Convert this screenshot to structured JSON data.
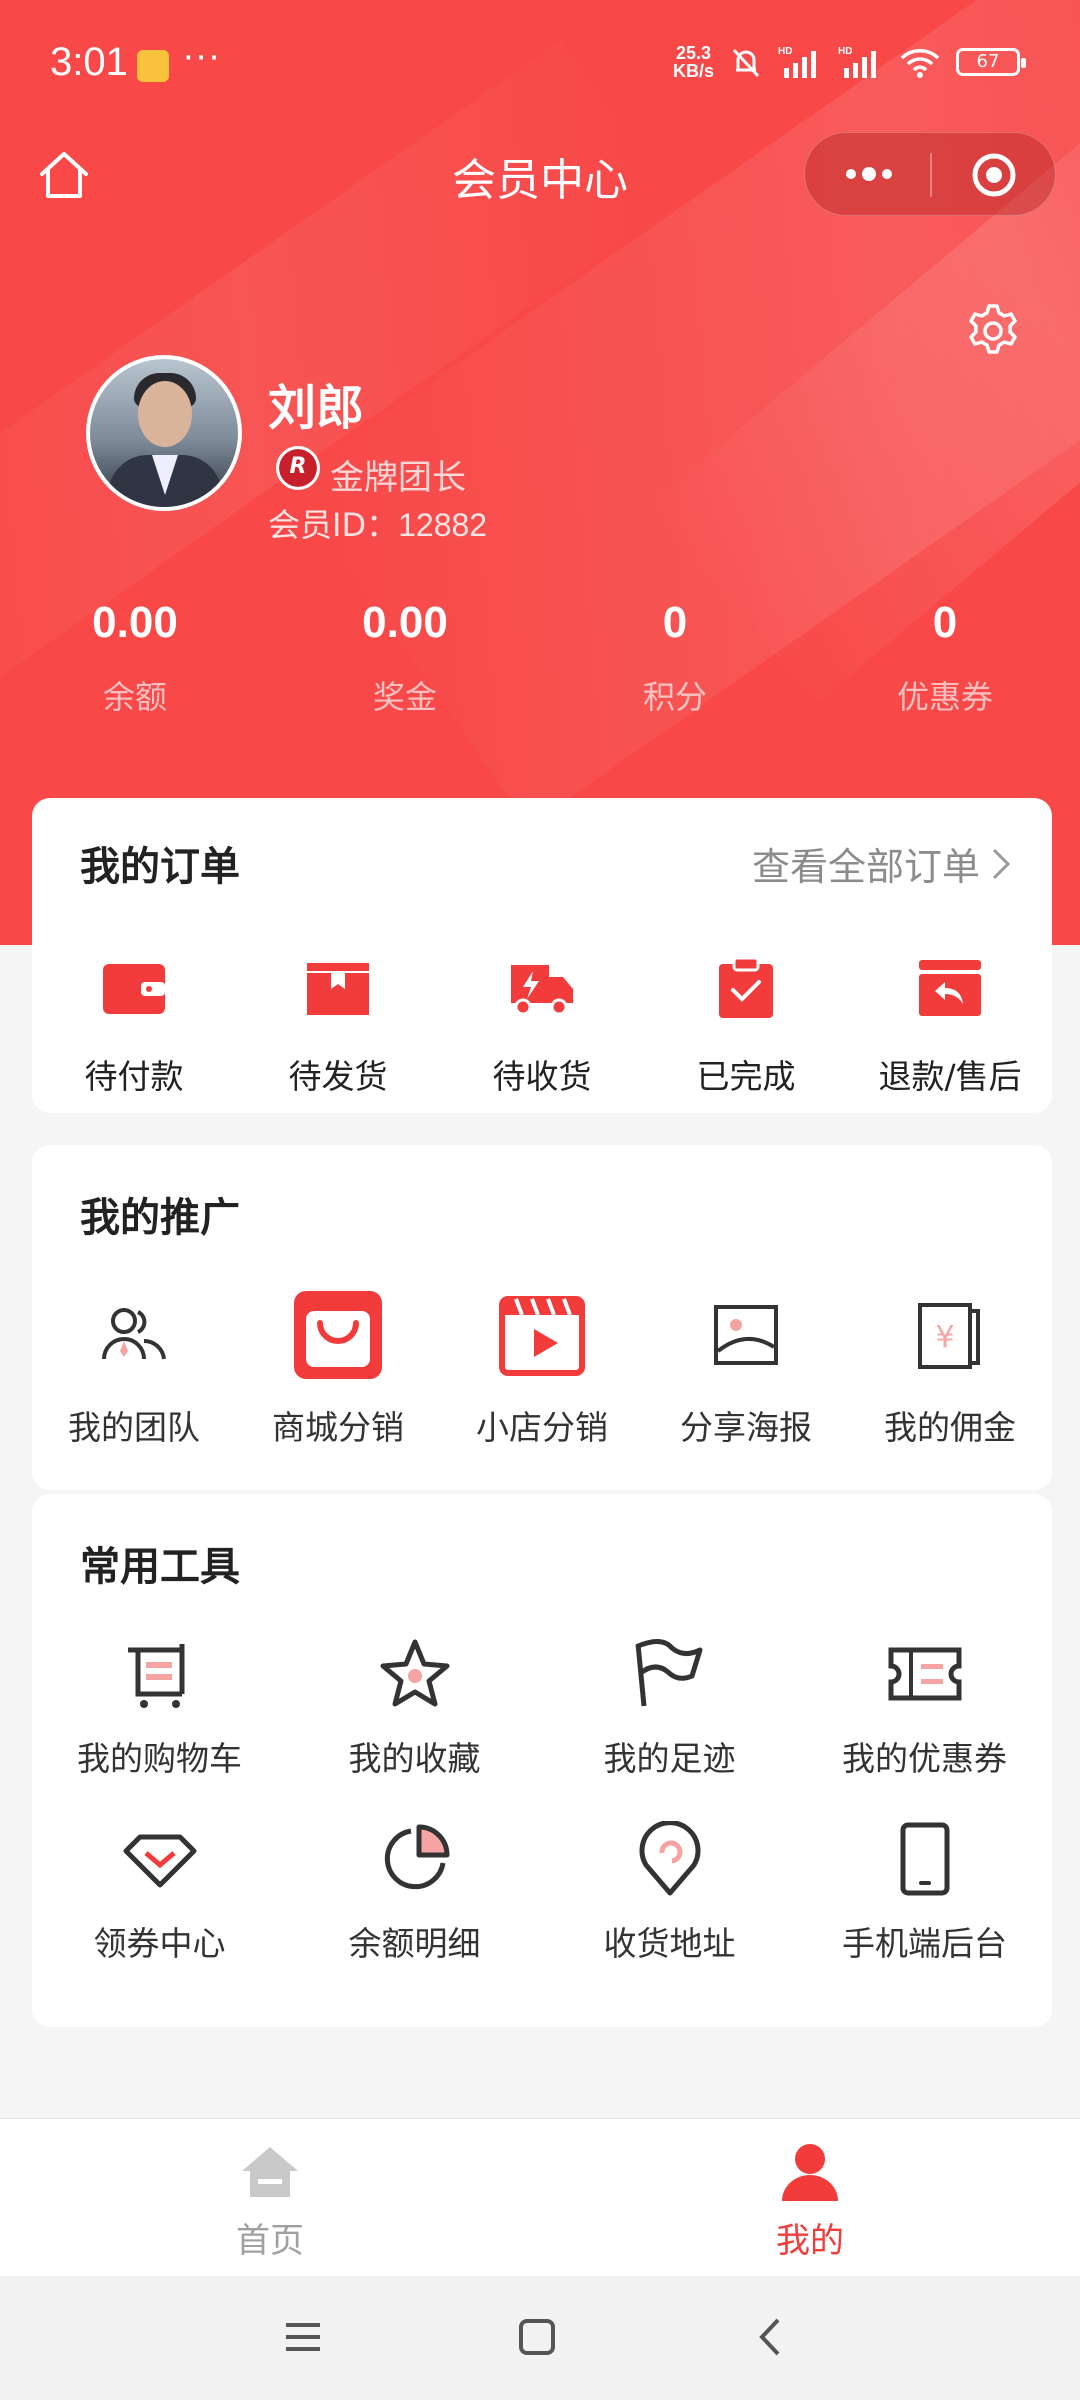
{
  "status_bar": {
    "time": "3:01",
    "dots": "···",
    "speed_top": "25.3",
    "speed_bottom": "KB/s",
    "battery": "67"
  },
  "nav": {
    "title": "会员中心"
  },
  "profile": {
    "name": "刘郎",
    "badge_text": "R",
    "level": "金牌团长",
    "member_id_label": "会员ID：",
    "member_id": "12882"
  },
  "stats": [
    {
      "value": "0.00",
      "label": "余额"
    },
    {
      "value": "0.00",
      "label": "奖金"
    },
    {
      "value": "0",
      "label": "积分"
    },
    {
      "value": "0",
      "label": "优惠券"
    }
  ],
  "orders": {
    "title": "我的订单",
    "view_all": "查看全部订单",
    "items": [
      {
        "label": "待付款",
        "icon": "wallet-icon"
      },
      {
        "label": "待发货",
        "icon": "box-icon"
      },
      {
        "label": "待收货",
        "icon": "delivery-truck-icon"
      },
      {
        "label": "已完成",
        "icon": "clipboard-check-icon"
      },
      {
        "label": "退款/售后",
        "icon": "return-box-icon"
      }
    ]
  },
  "promotion": {
    "title": "我的推广",
    "items": [
      {
        "label": "我的团队",
        "icon": "team-icon"
      },
      {
        "label": "商城分销",
        "icon": "shopping-bag-icon"
      },
      {
        "label": "小店分销",
        "icon": "video-play-icon"
      },
      {
        "label": "分享海报",
        "icon": "poster-image-icon"
      },
      {
        "label": "我的佣金",
        "icon": "commission-yuan-icon"
      }
    ]
  },
  "tools": {
    "title": "常用工具",
    "items": [
      {
        "label": "我的购物车",
        "icon": "cart-icon"
      },
      {
        "label": "我的收藏",
        "icon": "star-icon"
      },
      {
        "label": "我的足迹",
        "icon": "flag-icon"
      },
      {
        "label": "我的优惠券",
        "icon": "ticket-icon"
      },
      {
        "label": "领券中心",
        "icon": "diamond-icon"
      },
      {
        "label": "余额明细",
        "icon": "pie-chart-icon"
      },
      {
        "label": "收货地址",
        "icon": "location-pin-icon"
      },
      {
        "label": "手机端后台",
        "icon": "phone-icon"
      }
    ]
  },
  "tab_bar": [
    {
      "label": "首页",
      "icon": "home-icon"
    },
    {
      "label": "我的",
      "icon": "user-icon"
    }
  ],
  "colors": {
    "brand_red": "#f84848",
    "icon_red": "#f23c3c",
    "icon_pink": "#f5a3a3",
    "icon_dark": "#333333"
  }
}
